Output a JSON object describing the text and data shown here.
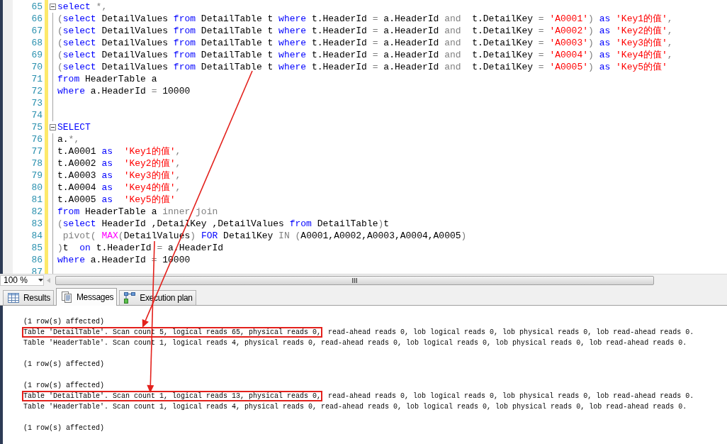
{
  "editor": {
    "lines": [
      {
        "number": "65",
        "fold": true,
        "tokens": [
          {
            "text": "select",
            "kind": "keyword"
          },
          {
            "text": " *,",
            "kind": "operator"
          }
        ]
      },
      {
        "number": "66",
        "fold": false,
        "tokens": [
          {
            "text": "(",
            "kind": "operator"
          },
          {
            "text": "select",
            "kind": "keyword"
          },
          {
            "text": " DetailValues ",
            "kind": "plain"
          },
          {
            "text": "from",
            "kind": "keyword"
          },
          {
            "text": " DetailTable t ",
            "kind": "plain"
          },
          {
            "text": "where",
            "kind": "keyword"
          },
          {
            "text": " t.HeaderId ",
            "kind": "plain"
          },
          {
            "text": "=",
            "kind": "operator"
          },
          {
            "text": " a.HeaderId ",
            "kind": "plain"
          },
          {
            "text": "and",
            "kind": "operator"
          },
          {
            "text": "  t.DetailKey ",
            "kind": "plain"
          },
          {
            "text": "= ",
            "kind": "operator"
          },
          {
            "text": "'A0001'",
            "kind": "string"
          },
          {
            "text": ") ",
            "kind": "operator"
          },
          {
            "text": "as ",
            "kind": "keyword"
          },
          {
            "text": "'Key1的值'",
            "kind": "string"
          },
          {
            "text": ",",
            "kind": "operator"
          }
        ]
      },
      {
        "number": "67",
        "fold": false,
        "tokens": [
          {
            "text": "(",
            "kind": "operator"
          },
          {
            "text": "select",
            "kind": "keyword"
          },
          {
            "text": " DetailValues ",
            "kind": "plain"
          },
          {
            "text": "from",
            "kind": "keyword"
          },
          {
            "text": " DetailTable t ",
            "kind": "plain"
          },
          {
            "text": "where",
            "kind": "keyword"
          },
          {
            "text": " t.HeaderId ",
            "kind": "plain"
          },
          {
            "text": "=",
            "kind": "operator"
          },
          {
            "text": " a.HeaderId ",
            "kind": "plain"
          },
          {
            "text": "and",
            "kind": "operator"
          },
          {
            "text": "  t.DetailKey ",
            "kind": "plain"
          },
          {
            "text": "= ",
            "kind": "operator"
          },
          {
            "text": "'A0002'",
            "kind": "string"
          },
          {
            "text": ") ",
            "kind": "operator"
          },
          {
            "text": "as ",
            "kind": "keyword"
          },
          {
            "text": "'Key2的值'",
            "kind": "string"
          },
          {
            "text": ",",
            "kind": "operator"
          }
        ]
      },
      {
        "number": "68",
        "fold": false,
        "tokens": [
          {
            "text": "(",
            "kind": "operator"
          },
          {
            "text": "select",
            "kind": "keyword"
          },
          {
            "text": " DetailValues ",
            "kind": "plain"
          },
          {
            "text": "from",
            "kind": "keyword"
          },
          {
            "text": " DetailTable t ",
            "kind": "plain"
          },
          {
            "text": "where",
            "kind": "keyword"
          },
          {
            "text": " t.HeaderId ",
            "kind": "plain"
          },
          {
            "text": "=",
            "kind": "operator"
          },
          {
            "text": " a.HeaderId ",
            "kind": "plain"
          },
          {
            "text": "and",
            "kind": "operator"
          },
          {
            "text": "  t.DetailKey ",
            "kind": "plain"
          },
          {
            "text": "= ",
            "kind": "operator"
          },
          {
            "text": "'A0003'",
            "kind": "string"
          },
          {
            "text": ") ",
            "kind": "operator"
          },
          {
            "text": "as ",
            "kind": "keyword"
          },
          {
            "text": "'Key3的值'",
            "kind": "string"
          },
          {
            "text": ",",
            "kind": "operator"
          }
        ]
      },
      {
        "number": "69",
        "fold": false,
        "tokens": [
          {
            "text": "(",
            "kind": "operator"
          },
          {
            "text": "select",
            "kind": "keyword"
          },
          {
            "text": " DetailValues ",
            "kind": "plain"
          },
          {
            "text": "from",
            "kind": "keyword"
          },
          {
            "text": " DetailTable t ",
            "kind": "plain"
          },
          {
            "text": "where",
            "kind": "keyword"
          },
          {
            "text": " t.HeaderId ",
            "kind": "plain"
          },
          {
            "text": "=",
            "kind": "operator"
          },
          {
            "text": " a.HeaderId ",
            "kind": "plain"
          },
          {
            "text": "and",
            "kind": "operator"
          },
          {
            "text": "  t.DetailKey ",
            "kind": "plain"
          },
          {
            "text": "= ",
            "kind": "operator"
          },
          {
            "text": "'A0004'",
            "kind": "string"
          },
          {
            "text": ") ",
            "kind": "operator"
          },
          {
            "text": "as ",
            "kind": "keyword"
          },
          {
            "text": "'Key4的值'",
            "kind": "string"
          },
          {
            "text": ",",
            "kind": "operator"
          }
        ]
      },
      {
        "number": "70",
        "fold": false,
        "tokens": [
          {
            "text": "(",
            "kind": "operator"
          },
          {
            "text": "select",
            "kind": "keyword"
          },
          {
            "text": " DetailValues ",
            "kind": "plain"
          },
          {
            "text": "from",
            "kind": "keyword"
          },
          {
            "text": " DetailTable t ",
            "kind": "plain"
          },
          {
            "text": "where",
            "kind": "keyword"
          },
          {
            "text": " t.HeaderId ",
            "kind": "plain"
          },
          {
            "text": "=",
            "kind": "operator"
          },
          {
            "text": " a.HeaderId ",
            "kind": "plain"
          },
          {
            "text": "and",
            "kind": "operator"
          },
          {
            "text": "  t.DetailKey ",
            "kind": "plain"
          },
          {
            "text": "= ",
            "kind": "operator"
          },
          {
            "text": "'A0005'",
            "kind": "string"
          },
          {
            "text": ") ",
            "kind": "operator"
          },
          {
            "text": "as ",
            "kind": "keyword"
          },
          {
            "text": "'Key5的值'",
            "kind": "string"
          }
        ]
      },
      {
        "number": "71",
        "fold": false,
        "tokens": [
          {
            "text": "from",
            "kind": "keyword"
          },
          {
            "text": " HeaderTable a",
            "kind": "plain"
          }
        ]
      },
      {
        "number": "72",
        "fold": false,
        "tokens": [
          {
            "text": "where",
            "kind": "keyword"
          },
          {
            "text": " a.HeaderId ",
            "kind": "plain"
          },
          {
            "text": "=",
            "kind": "operator"
          },
          {
            "text": " 10000",
            "kind": "plain"
          }
        ]
      },
      {
        "number": "73",
        "fold": false
      },
      {
        "number": "74",
        "fold": false
      },
      {
        "number": "75",
        "fold": true,
        "tokens": [
          {
            "text": "SELECT",
            "kind": "keyword"
          }
        ]
      },
      {
        "number": "76",
        "fold": false,
        "tokens": [
          {
            "text": "a.",
            "kind": "plain"
          },
          {
            "text": "*,",
            "kind": "operator"
          }
        ]
      },
      {
        "number": "77",
        "fold": false,
        "tokens": [
          {
            "text": "t.A0001 ",
            "kind": "plain"
          },
          {
            "text": "as  ",
            "kind": "keyword"
          },
          {
            "text": "'Key1的值'",
            "kind": "string"
          },
          {
            "text": ",",
            "kind": "operator"
          }
        ]
      },
      {
        "number": "78",
        "fold": false,
        "tokens": [
          {
            "text": "t.A0002 ",
            "kind": "plain"
          },
          {
            "text": "as  ",
            "kind": "keyword"
          },
          {
            "text": "'Key2的值'",
            "kind": "string"
          },
          {
            "text": ",",
            "kind": "operator"
          }
        ]
      },
      {
        "number": "79",
        "fold": false,
        "tokens": [
          {
            "text": "t.A0003 ",
            "kind": "plain"
          },
          {
            "text": "as  ",
            "kind": "keyword"
          },
          {
            "text": "'Key3的值'",
            "kind": "string"
          },
          {
            "text": ",",
            "kind": "operator"
          }
        ]
      },
      {
        "number": "80",
        "fold": false,
        "tokens": [
          {
            "text": "t.A0004 ",
            "kind": "plain"
          },
          {
            "text": "as  ",
            "kind": "keyword"
          },
          {
            "text": "'Key4的值'",
            "kind": "string"
          },
          {
            "text": ",",
            "kind": "operator"
          }
        ]
      },
      {
        "number": "81",
        "fold": false,
        "tokens": [
          {
            "text": "t.A0005 ",
            "kind": "plain"
          },
          {
            "text": "as  ",
            "kind": "keyword"
          },
          {
            "text": "'Key5的值'",
            "kind": "string"
          }
        ]
      },
      {
        "number": "82",
        "fold": false,
        "tokens": [
          {
            "text": "from",
            "kind": "keyword"
          },
          {
            "text": " HeaderTable a ",
            "kind": "plain"
          },
          {
            "text": "inner join",
            "kind": "operator"
          }
        ]
      },
      {
        "number": "83",
        "fold": false,
        "tokens": [
          {
            "text": "(",
            "kind": "operator"
          },
          {
            "text": "select",
            "kind": "keyword"
          },
          {
            "text": " HeaderId ,DetailKey ,DetailValues ",
            "kind": "plain"
          },
          {
            "text": "from",
            "kind": "keyword"
          },
          {
            "text": " DetailTable",
            "kind": "plain"
          },
          {
            "text": ")",
            "kind": "operator"
          },
          {
            "text": "t",
            "kind": "plain"
          }
        ]
      },
      {
        "number": "84",
        "fold": false,
        "tokens": [
          {
            "text": " pivot( ",
            "kind": "operator"
          },
          {
            "text": "MAX",
            "kind": "function"
          },
          {
            "text": "(",
            "kind": "operator"
          },
          {
            "text": "DetailValues",
            "kind": "plain"
          },
          {
            "text": ") ",
            "kind": "operator"
          },
          {
            "text": "FOR",
            "kind": "keyword"
          },
          {
            "text": " DetailKey ",
            "kind": "plain"
          },
          {
            "text": "IN (",
            "kind": "operator"
          },
          {
            "text": "A0001,A0002,A0003,A0004,A0005",
            "kind": "plain"
          },
          {
            "text": ")",
            "kind": "operator"
          }
        ]
      },
      {
        "number": "85",
        "fold": false,
        "tokens": [
          {
            "text": ")",
            "kind": "operator"
          },
          {
            "text": "t  ",
            "kind": "plain"
          },
          {
            "text": "on",
            "kind": "keyword"
          },
          {
            "text": " t.HeaderId ",
            "kind": "plain"
          },
          {
            "text": "=",
            "kind": "operator"
          },
          {
            "text": " a.HeaderId",
            "kind": "plain"
          }
        ]
      },
      {
        "number": "86",
        "fold": false,
        "tokens": [
          {
            "text": "where",
            "kind": "keyword"
          },
          {
            "text": " a.HeaderId ",
            "kind": "plain"
          },
          {
            "text": "=",
            "kind": "operator"
          },
          {
            "text": " 10000",
            "kind": "plain"
          }
        ]
      },
      {
        "number": "87",
        "fold": false
      }
    ]
  },
  "zoom": "100 %",
  "tabs": [
    {
      "label": "Results",
      "kind": "grid",
      "selected": false
    },
    {
      "label": "Messages",
      "kind": "messages",
      "selected": true
    },
    {
      "label": "Execution plan",
      "kind": "plan",
      "selected": false
    }
  ],
  "messages": [
    [
      {
        "parts": [
          {
            "text": "(1 row(s) affected)",
            "highlighted": false
          }
        ]
      },
      {
        "parts": [
          {
            "text": "Table 'DetailTable'. Scan count 5, logical reads 65, physical reads 0,",
            "highlighted": true
          },
          {
            "text": " read-ahead reads 0, lob logical reads 0, lob physical reads 0, lob read-ahead reads 0.",
            "highlighted": false
          }
        ]
      },
      {
        "parts": [
          {
            "text": "Table 'HeaderTable'. Scan count 1, logical reads 4, physical reads 0, read-ahead reads 0, lob logical reads 0, lob physical reads 0, lob read-ahead reads 0.",
            "highlighted": false
          }
        ]
      }
    ],
    [
      {
        "parts": [
          {
            "text": "(1 row(s) affected)",
            "highlighted": false
          }
        ]
      }
    ],
    [
      {
        "parts": [
          {
            "text": "(1 row(s) affected)",
            "highlighted": false
          }
        ]
      },
      {
        "parts": [
          {
            "text": "Table 'DetailTable'. Scan count 1, logical reads 13, physical reads 0,",
            "highlighted": true
          },
          {
            "text": " read-ahead reads 0, lob logical reads 0, lob physical reads 0, lob read-ahead reads 0.",
            "highlighted": false
          }
        ]
      },
      {
        "parts": [
          {
            "text": "Table 'HeaderTable'. Scan count 1, logical reads 4, physical reads 0, read-ahead reads 0, lob logical reads 0, lob physical reads 0, lob read-ahead reads 0.",
            "highlighted": false
          }
        ]
      }
    ],
    [
      {
        "parts": [
          {
            "text": "(1 row(s) affected)",
            "highlighted": false
          }
        ]
      }
    ]
  ],
  "annotations": [
    {
      "kind": "arrow"
    },
    {
      "kind": "arrow"
    }
  ]
}
